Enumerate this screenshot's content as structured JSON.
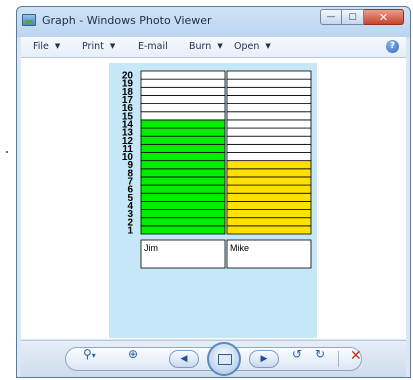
{
  "window": {
    "title": "Graph - Windows Photo Viewer",
    "minimize_glyph": "—",
    "maximize_glyph": "▢",
    "close_glyph": "✕"
  },
  "menu": {
    "file": "File",
    "print": "Print",
    "email": "E-mail",
    "burn": "Burn",
    "open": "Open",
    "dropdown_glyph": "▼",
    "help_glyph": "?"
  },
  "toolbar": {
    "zoom_glyph": "⚲",
    "zoom_caret": "▾",
    "actual_size_glyph": "⊕",
    "prev_glyph": "◀",
    "next_glyph": "▶",
    "rotate_ccw_glyph": "↺",
    "rotate_cw_glyph": "↻",
    "delete_glyph": "✕"
  },
  "colors": {
    "panel": "#c5e7f8",
    "empty_cell": "#ffffff",
    "grid": "#000000",
    "jim": "#00ee00",
    "mike": "#ffe000"
  },
  "chart_data": {
    "type": "bar",
    "categories": [
      "Jim",
      "Mike"
    ],
    "values": [
      14,
      9
    ],
    "y_ticks": [
      1,
      2,
      3,
      4,
      5,
      6,
      7,
      8,
      9,
      10,
      11,
      12,
      13,
      14,
      15,
      16,
      17,
      18,
      19,
      20
    ],
    "ylim": [
      0,
      20
    ],
    "grid": true
  }
}
